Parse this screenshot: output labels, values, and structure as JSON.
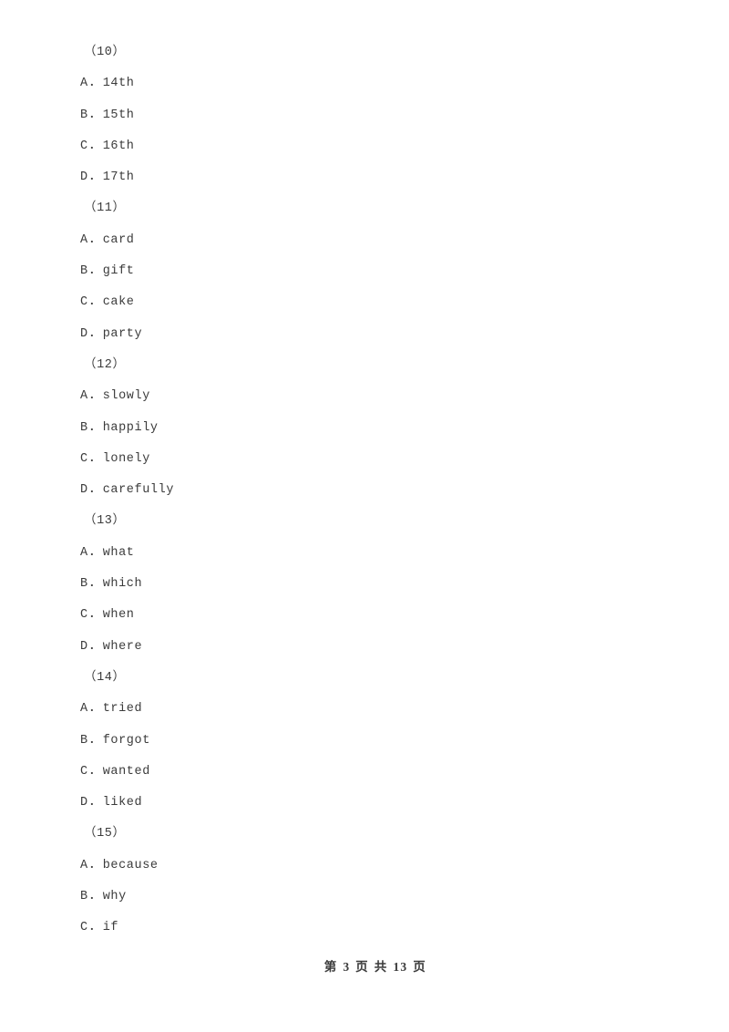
{
  "document": {
    "page_background": "#ffffff",
    "text_color": "#3b3b3b"
  },
  "questions": [
    {
      "number": "（10）",
      "options": [
        {
          "letter": "A",
          "dot": "．",
          "text": "14th"
        },
        {
          "letter": "B",
          "dot": "．",
          "text": "15th"
        },
        {
          "letter": "C",
          "dot": "．",
          "text": "16th"
        },
        {
          "letter": "D",
          "dot": "．",
          "text": "17th"
        }
      ]
    },
    {
      "number": "（11）",
      "options": [
        {
          "letter": "A",
          "dot": "．",
          "text": "card"
        },
        {
          "letter": "B",
          "dot": "．",
          "text": "gift"
        },
        {
          "letter": "C",
          "dot": "．",
          "text": "cake"
        },
        {
          "letter": "D",
          "dot": "．",
          "text": "party"
        }
      ]
    },
    {
      "number": "（12）",
      "options": [
        {
          "letter": "A",
          "dot": "．",
          "text": "slowly"
        },
        {
          "letter": "B",
          "dot": "．",
          "text": "happily"
        },
        {
          "letter": "C",
          "dot": "．",
          "text": "lonely"
        },
        {
          "letter": "D",
          "dot": "．",
          "text": "carefully"
        }
      ]
    },
    {
      "number": "（13）",
      "options": [
        {
          "letter": "A",
          "dot": "．",
          "text": "what"
        },
        {
          "letter": "B",
          "dot": "．",
          "text": "which"
        },
        {
          "letter": "C",
          "dot": "．",
          "text": "when"
        },
        {
          "letter": "D",
          "dot": "．",
          "text": "where"
        }
      ]
    },
    {
      "number": "（14）",
      "options": [
        {
          "letter": "A",
          "dot": "．",
          "text": "tried"
        },
        {
          "letter": "B",
          "dot": "．",
          "text": "forgot"
        },
        {
          "letter": "C",
          "dot": "．",
          "text": "wanted"
        },
        {
          "letter": "D",
          "dot": "．",
          "text": "liked"
        }
      ]
    },
    {
      "number": "（15）",
      "options": [
        {
          "letter": "A",
          "dot": "．",
          "text": "because"
        },
        {
          "letter": "B",
          "dot": "．",
          "text": "why"
        },
        {
          "letter": "C",
          "dot": "．",
          "text": "if"
        }
      ]
    }
  ],
  "footer": {
    "prefix": "第",
    "current_page": "3",
    "middle": "页 共",
    "total_pages": "13",
    "suffix": "页",
    "full_text": "第 3 页 共 13 页"
  }
}
